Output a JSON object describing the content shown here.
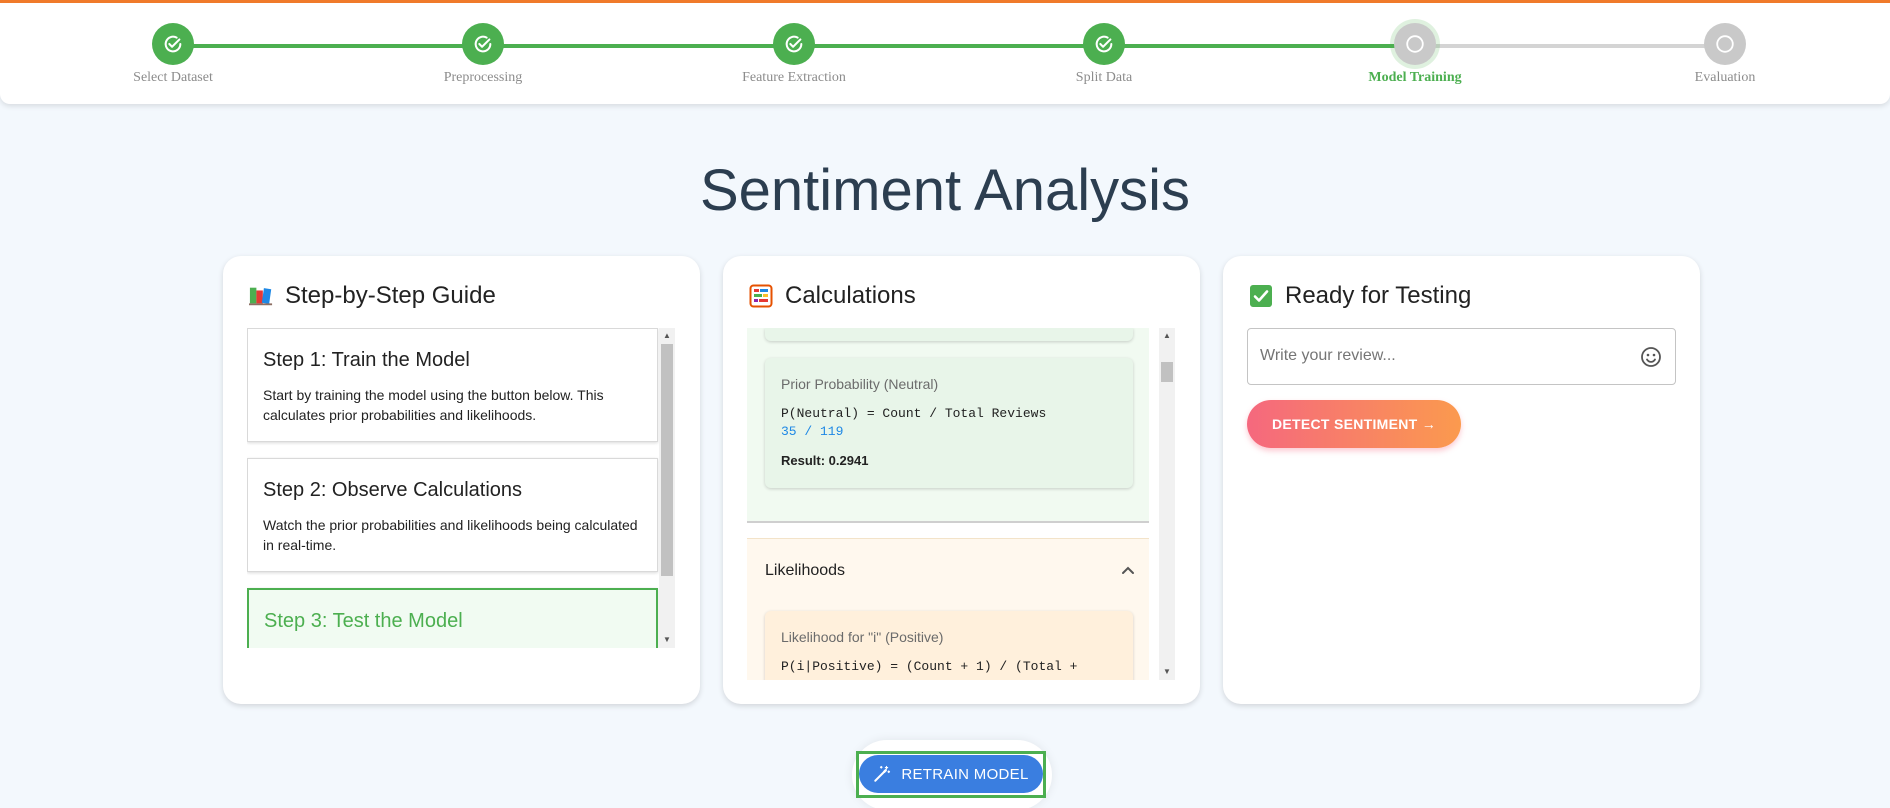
{
  "stepper": {
    "steps": [
      {
        "label": "Select Dataset",
        "state": "done"
      },
      {
        "label": "Preprocessing",
        "state": "done"
      },
      {
        "label": "Feature Extraction",
        "state": "done"
      },
      {
        "label": "Split Data",
        "state": "done"
      },
      {
        "label": "Model Training",
        "state": "active"
      },
      {
        "label": "Evaluation",
        "state": "pending"
      }
    ]
  },
  "page_title": "Sentiment Analysis",
  "guide": {
    "title": "Step-by-Step Guide",
    "steps": [
      {
        "title": "Step 1: Train the Model",
        "text": "Start by training the model using the button below. This calculates prior probabilities and likelihoods."
      },
      {
        "title": "Step 2: Observe Calculations",
        "text": "Watch the prior probabilities and likelihoods being calculated in real-time."
      },
      {
        "title": "Step 3: Test the Model",
        "text": ""
      }
    ]
  },
  "calculations": {
    "title": "Calculations",
    "prior_neutral": {
      "title": "Prior Probability (Neutral)",
      "formula": "P(Neutral) = Count / Total Reviews",
      "values": "35 / 119",
      "result": "Result: 0.2941"
    },
    "likelihoods": {
      "header": "Likelihoods",
      "item": {
        "title": "Likelihood for \"i\" (Positive)",
        "formula": "P(i|Positive) = (Count + 1) / (Total +"
      }
    }
  },
  "testing": {
    "title": "Ready for Testing",
    "review_placeholder": "Write your review...",
    "detect_label": "DETECT SENTIMENT →"
  },
  "retrain_label": "RETRAIN MODEL",
  "colors": {
    "accent_green": "#4caf50",
    "blue": "#3a7ee0",
    "orange": "#f07a2a"
  }
}
